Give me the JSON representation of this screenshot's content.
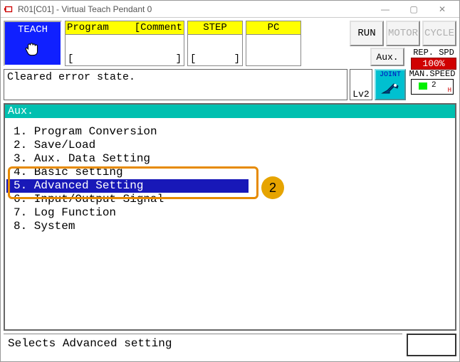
{
  "window": {
    "title": "R01[C01] - Virtual Teach Pendant 0"
  },
  "top": {
    "teach_label": "TEACH",
    "program_head_left": "Program",
    "program_head_right": "[Comment",
    "program_body_left": "[",
    "program_body_right": "]",
    "step_head": "STEP",
    "step_body_left": "[",
    "step_body_right": "]",
    "pc_head": "PC",
    "run_label": "RUN",
    "motor_label": "MOTOR",
    "cycle_label": "CYCLE",
    "aux_label": "Aux.",
    "repspd_label": "REP. SPD",
    "repspd_value": "100%"
  },
  "status": {
    "message": "Cleared error state.",
    "lv2": "Lv2",
    "joint_label": "JOINT",
    "manspd_label": "MAN.SPEED",
    "manspd_value": "2",
    "manspd_h": "H"
  },
  "main": {
    "title": "Aux.",
    "items": [
      "1. Program Conversion",
      "2. Save/Load",
      "3. Aux. Data Setting",
      "4. Basic setting",
      "5. Advanced Setting",
      "6. Input/Output Signal",
      "7. Log Function",
      "8. System"
    ],
    "selected_index": 4,
    "callout_badge": "2"
  },
  "footer": {
    "hint": "Selects Advanced setting"
  }
}
